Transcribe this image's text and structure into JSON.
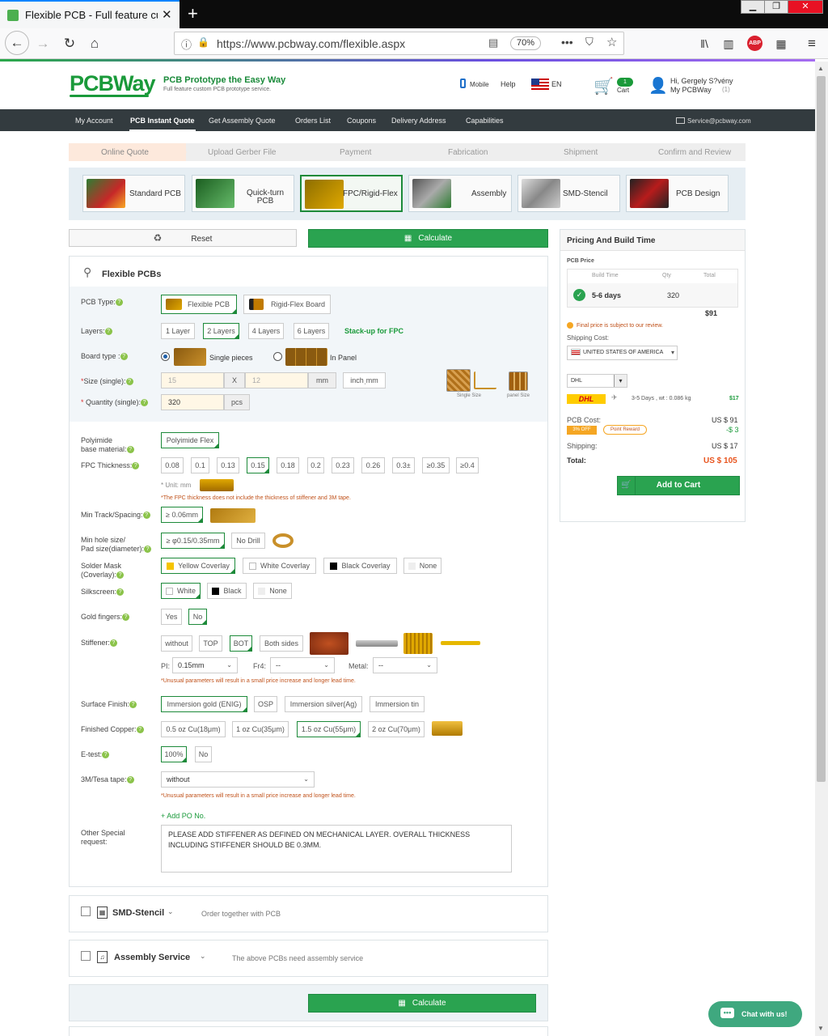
{
  "browser": {
    "tab_title": "Flexible PCB - Full feature custo",
    "url": "https://www.pcbway.com/flexible.aspx",
    "zoom": "70%",
    "adblock": "ABP"
  },
  "header": {
    "logo": "PCBWay",
    "slogan": "PCB Prototype the Easy Way",
    "sub_slogan": "Full feature custom PCB prototype service.",
    "mobile": "Mobile",
    "help": "Help",
    "lang": "EN",
    "cart_count": "1",
    "cart": "Cart",
    "greeting": "Hi, Gergely S?vény",
    "my_account": "My PCBWay",
    "my_account_count": "(1)"
  },
  "nav": {
    "items": [
      "My Account",
      "PCB Instant Quote",
      "Get Assembly Quote",
      "Orders List",
      "Coupons",
      "Delivery Address",
      "Capabilities"
    ],
    "email": "Service@pcbway.com"
  },
  "steps": [
    "Online Quote",
    "Upload Gerber File",
    "Payment",
    "Fabrication",
    "Shipment",
    "Confirm and Review"
  ],
  "categories": [
    "Standard PCB",
    "Quick-turn PCB",
    "FPC/Rigid-Flex",
    "Assembly",
    "SMD-Stencil",
    "PCB Design"
  ],
  "actions": {
    "reset": "Reset",
    "calculate": "Calculate"
  },
  "form": {
    "section_title": "Flexible PCBs",
    "pcb_type_label": "PCB Type:",
    "pcb_types": [
      "Flexible PCB",
      "Rigid-Flex Board"
    ],
    "layers_label": "Layers:",
    "layers": [
      "1 Layer",
      "2 Layers",
      "4 Layers",
      "6 Layers"
    ],
    "stackup": "Stack-up for FPC",
    "board_type_label": "Board type :",
    "board_single": "Single pieces",
    "board_panel": "In Panel",
    "size_label": "Size (single):",
    "size_w": "15",
    "size_x": "X",
    "size_h": "12",
    "size_unit": "mm",
    "size_toggle": "inchˌmm",
    "single_size": "Single Size",
    "panel_size": "panel Size",
    "qty_label": "Quantity (single):",
    "qty": "320",
    "qty_unit": "pcs",
    "base_label_1": "Polyimide",
    "base_label_2": "base material:",
    "base_value": "Polyimide Flex",
    "thickness_label": "FPC Thickness:",
    "thicknesses": [
      "0.08",
      "0.1",
      "0.13",
      "0.15",
      "0.18",
      "0.2",
      "0.23",
      "0.26",
      "0.3±",
      "≥0.35",
      "≥0.4"
    ],
    "unit_note": "* Unit: mm",
    "thickness_note": "*The FPC thickness does not include the thickness of stiffener and 3M tape.",
    "track_label": "Min Track/Spacing:",
    "track_value": "≥ 0.06mm",
    "hole_label_1": "Min hole size/",
    "hole_label_2": "Pad size(diameter):",
    "hole_values": [
      "≥ φ0.15/0.35mm",
      "No Drill"
    ],
    "mask_label_1": "Solder Mask",
    "mask_label_2": "(Coverlay):",
    "mask_values": [
      "Yellow Coverlay",
      "White Coverlay",
      "Black Coverlay",
      "None"
    ],
    "silk_label": "Silkscreen:",
    "silk_values": [
      "White",
      "Black",
      "None"
    ],
    "gold_label": "Gold fingers:",
    "gold_values": [
      "Yes",
      "No"
    ],
    "stiffener_label": "Stiffener:",
    "stiffener_values": [
      "without",
      "TOP",
      "BOT",
      "Both sides"
    ],
    "pi_label": "PI:",
    "pi_value": "0.15mm",
    "fr4_label": "Fr4:",
    "fr4_value": "--",
    "metal_label": "Metal:",
    "metal_value": "--",
    "unusual_note": "*Unusual parameters will result in a small price increase and longer lead time.",
    "finish_label": "Surface Finish:",
    "finish_values": [
      "Immersion gold (ENIG)",
      "OSP",
      "Immersion silver(Ag)",
      "Immersion tin"
    ],
    "copper_label": "Finished Copper:",
    "copper_values": [
      "0.5 oz Cu(18μm)",
      "1 oz Cu(35μm)",
      "1.5 oz Cu(55μm)",
      "2 oz Cu(70μm)"
    ],
    "etest_label": "E-test:",
    "etest_values": [
      "100%",
      "No"
    ],
    "tape_label": "3M/Tesa tape:",
    "tape_value": "without",
    "add_po": "+ Add PO No.",
    "special_label_1": "Other Special",
    "special_label_2": "request:",
    "special_text": "PLEASE ADD STIFFENER AS DEFINED ON MECHANICAL LAYER. OVERALL THICKNESS INCLUDING STIFFENER SHOULD BE 0.3MM."
  },
  "addons": [
    {
      "title": "SMD-Stencil",
      "note": "Order together with PCB"
    },
    {
      "title": "Assembly Service",
      "note": "The above PCBs need assembly service"
    }
  ],
  "pricing": {
    "title": "Pricing And Build Time",
    "pcb_price": "PCB Price",
    "cols": [
      "Build Time",
      "Qty",
      "Total"
    ],
    "build_time": "5-6 days",
    "qty": "320",
    "row_total": "$91",
    "warning": "Final price is subject to our review.",
    "shipping_cost": "Shipping Cost:",
    "country": "UNITED STATES OF AMERICA",
    "carrier": "DHL",
    "carrier_logo": "DHL",
    "ship_days": "3-5 Days ,  wt : 0.086 kg",
    "ship_price": "$17",
    "pcb_cost_label": "PCB Cost:",
    "pcb_cost": "US $ 91",
    "off_badge": "3% OFF",
    "reward": "Point Reward",
    "discount": "-$ 3",
    "shipping_label": "Shipping:",
    "shipping": "US $ 17",
    "total_label": "Total:",
    "total": "US $ 105",
    "add_to_cart": "Add to Cart"
  },
  "chat": "Chat with us!"
}
